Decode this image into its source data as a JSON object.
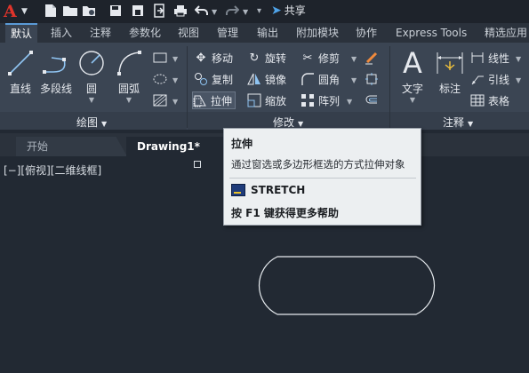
{
  "quick_access": {
    "share_label": "共享"
  },
  "ribbon_tabs": [
    "默认",
    "插入",
    "注释",
    "参数化",
    "视图",
    "管理",
    "输出",
    "附加模块",
    "协作",
    "Express Tools",
    "精选应用"
  ],
  "draw_panel": {
    "title": "绘图",
    "tools": {
      "line": "直线",
      "polyline": "多段线",
      "circle": "圆",
      "arc": "圆弧"
    }
  },
  "modify_panel": {
    "title": "修改",
    "tools": {
      "move": "移动",
      "rotate": "旋转",
      "trim": "修剪",
      "copy": "复制",
      "mirror": "镜像",
      "fillet": "圆角",
      "stretch": "拉伸",
      "scale": "缩放",
      "array": "阵列"
    }
  },
  "annotation_panel": {
    "title": "注释",
    "tools": {
      "text": "文字",
      "dimension": "标注",
      "linear": "线性",
      "leader": "引线",
      "table": "表格"
    }
  },
  "document_tabs": {
    "home": "开始",
    "active": "Drawing1*"
  },
  "viewport": {
    "label_minus": "[−]",
    "label_view": "[俯视]",
    "label_style": "[二维线框]"
  },
  "tooltip": {
    "title": "拉伸",
    "description": "通过窗选或多边形框选的方式拉伸对象",
    "command": "STRETCH",
    "help": "按 F1 键获得更多帮助"
  },
  "colors": {
    "accent_blue": "#5a9ad6",
    "logo_red": "#e0342b",
    "canvas_bg": "#222933"
  }
}
